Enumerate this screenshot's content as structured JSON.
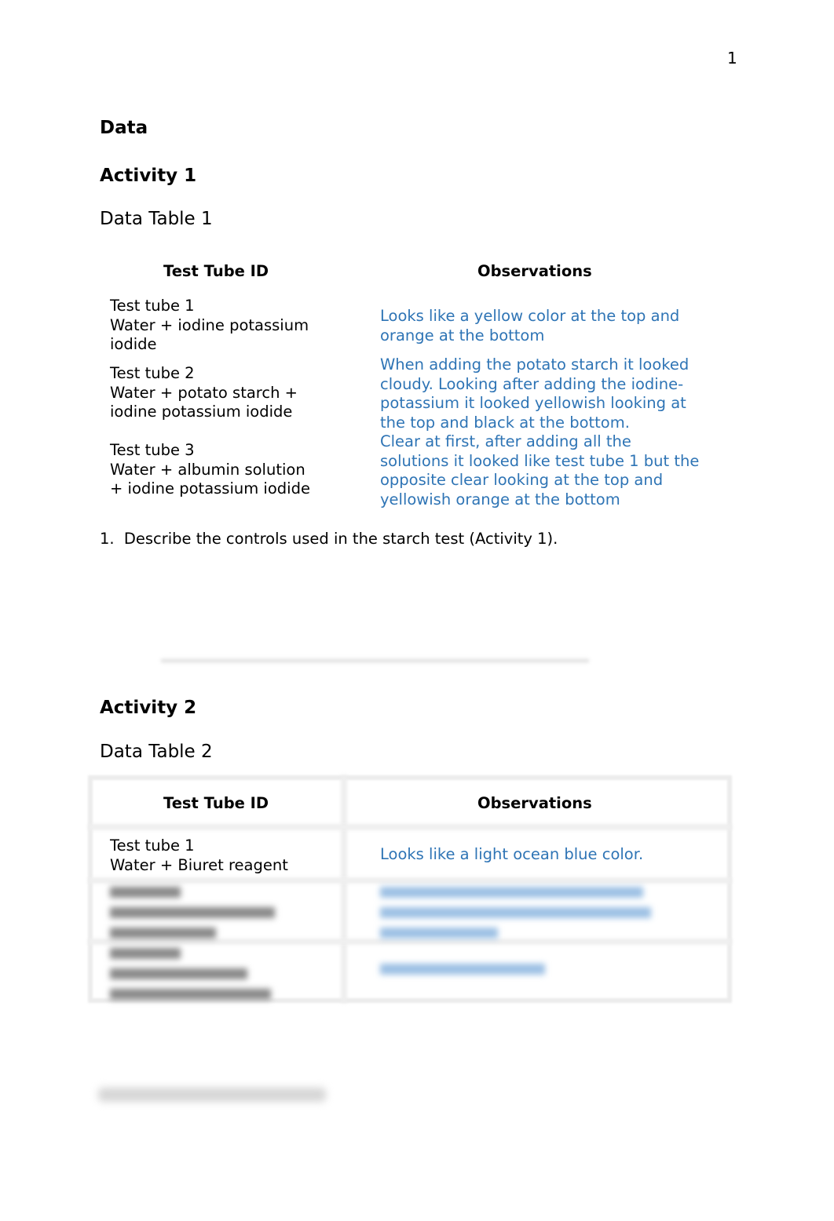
{
  "page_number": "1",
  "headings": {
    "data": "Data",
    "activity1": "Activity 1",
    "data_table1": "Data Table 1",
    "activity2": "Activity 2",
    "data_table2": "Data Table 2"
  },
  "table1": {
    "headers": [
      "Test Tube ID",
      "Observations"
    ],
    "rows": [
      {
        "id_lines": [
          "Test tube 1",
          "Water + iodine potassium",
          "iodide"
        ],
        "obs_lines": [
          "Looks like a yellow color at the top and",
          "orange at the bottom"
        ]
      },
      {
        "id_lines": [
          "Test tube 2",
          "Water + potato starch +",
          "iodine potassium iodide"
        ],
        "obs_lines": [
          "When adding the potato starch it looked",
          "cloudy. Looking after adding the iodine-",
          "potassium it looked yellowish looking at",
          "the top and black at the bottom."
        ]
      },
      {
        "id_lines": [
          "Test tube 3",
          "Water + albumin solution",
          "+ iodine potassium iodide"
        ],
        "obs_lines": [
          "Clear at first, after adding all the",
          "solutions it looked like test tube 1 but the",
          "opposite clear looking at the top and",
          "yellowish orange at the bottom"
        ]
      }
    ]
  },
  "question1": {
    "number": "1.",
    "text": "Describe the controls used in the starch test (Activity 1)."
  },
  "table2": {
    "headers": [
      "Test Tube ID",
      "Observations"
    ],
    "rows": [
      {
        "id_lines": [
          "Test tube 1",
          "Water + Biuret reagent"
        ],
        "obs_lines": [
          "Looks like a light ocean blue color."
        ]
      }
    ]
  },
  "colors": {
    "answer_text": "#2e74b5"
  }
}
